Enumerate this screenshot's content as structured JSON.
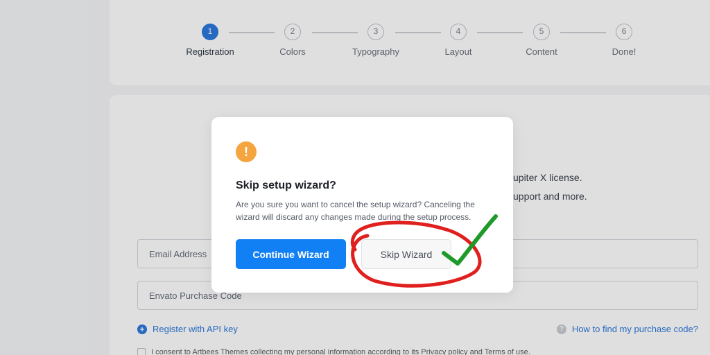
{
  "stepper": {
    "steps": [
      {
        "num": "1",
        "label": "Registration"
      },
      {
        "num": "2",
        "label": "Colors"
      },
      {
        "num": "3",
        "label": "Typography"
      },
      {
        "num": "4",
        "label": "Layout"
      },
      {
        "num": "5",
        "label": "Content"
      },
      {
        "num": "6",
        "label": "Done!"
      }
    ],
    "active_step": 1
  },
  "registration": {
    "license_line1": "upiter X license.",
    "license_line2": "upport and more.",
    "email_placeholder": "Email Address",
    "purchase_placeholder": "Envato Purchase Code",
    "register_link": "Register with API key",
    "help_link": "How to find my purchase code?",
    "consent_text": "I consent to Artbees Themes collecting my personal information according to its Privacy policy and Terms of use."
  },
  "modal": {
    "icon": "!",
    "title": "Skip setup wizard?",
    "body": "Are you sure you want to cancel the setup wizard? Canceling the wizard will discard any changes made during the setup process.",
    "continue_label": "Continue Wizard",
    "skip_label": "Skip Wizard"
  },
  "colors": {
    "accent": "#1180f5",
    "warning": "#f5a53f",
    "annotation_circle": "#e0201e",
    "annotation_check": "#1f9a2a"
  },
  "icons": {
    "warning": "warning-icon",
    "plus": "plus-circle-icon",
    "help": "question-circle-icon"
  }
}
